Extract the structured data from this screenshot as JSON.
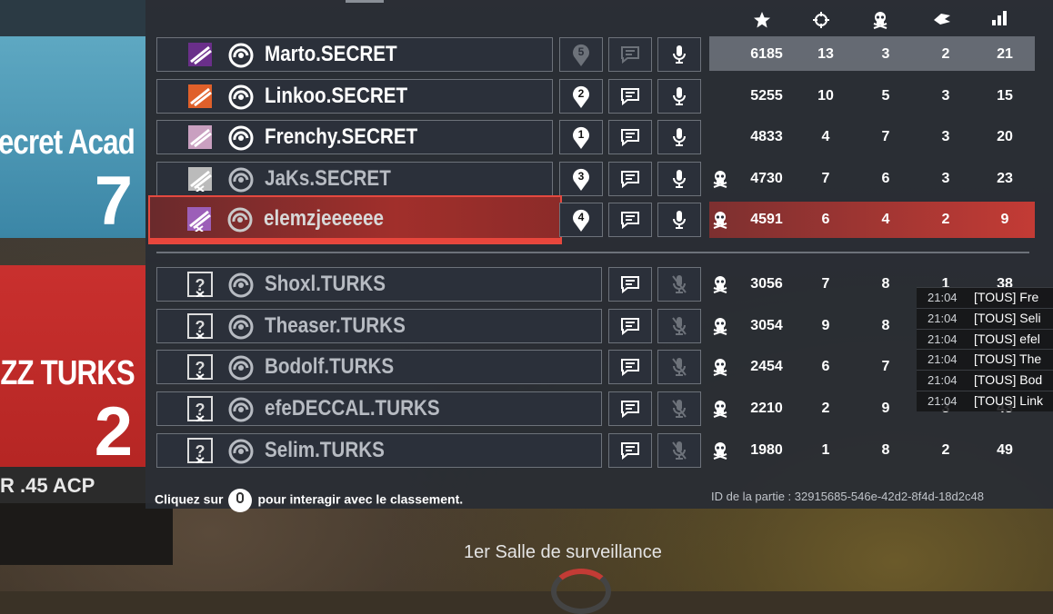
{
  "teams": [
    {
      "name": "ecret Acad",
      "score": "7",
      "color": "#4a97b5"
    },
    {
      "name": "ZZ TURKS",
      "score": "2",
      "color": "#c12c2a"
    }
  ],
  "weapon": "R .45 ACP",
  "header_icons": [
    "star-icon",
    "crosshair-icon",
    "skull-icon",
    "assist-icon",
    "signal-icon"
  ],
  "players": [
    {
      "name": "Marto.SECRET",
      "team": "secret",
      "badge": "5",
      "badge_state": "dim",
      "chat": "dim",
      "mic": "on",
      "dead": false,
      "score": "6185",
      "kills": "13",
      "deaths": "3",
      "assists": "2",
      "ping": "21"
    },
    {
      "name": "Linkoo.SECRET",
      "team": "secret",
      "badge": "2",
      "chat": "on",
      "mic": "on",
      "dead": false,
      "score": "5255",
      "kills": "10",
      "deaths": "5",
      "assists": "3",
      "ping": "15"
    },
    {
      "name": "Frenchy.SECRET",
      "team": "secret",
      "badge": "1",
      "chat": "on",
      "mic": "on",
      "dead": false,
      "score": "4833",
      "kills": "4",
      "deaths": "7",
      "assists": "3",
      "ping": "20"
    },
    {
      "name": "JaKs.SECRET",
      "team": "secret",
      "badge": "3",
      "chat": "on",
      "mic": "on",
      "dead": true,
      "score": "4730",
      "kills": "7",
      "deaths": "6",
      "assists": "3",
      "ping": "23"
    },
    {
      "name": "elemzjeeeeee",
      "team": "secret",
      "badge": "4",
      "chat": "on",
      "mic": "on",
      "dead": true,
      "score": "4591",
      "kills": "6",
      "deaths": "4",
      "assists": "2",
      "ping": "9",
      "self": true
    },
    {
      "name": "Shoxl.TURKS",
      "team": "turks",
      "chat": "on",
      "mic": "muted",
      "dead": true,
      "score": "3056",
      "kills": "7",
      "deaths": "8",
      "assists": "1",
      "ping": "38"
    },
    {
      "name": "Theaser.TURKS",
      "team": "turks",
      "chat": "on",
      "mic": "muted",
      "dead": true,
      "score": "3054",
      "kills": "9",
      "deaths": "8",
      "assists": "",
      "ping": ""
    },
    {
      "name": "Bodolf.TURKS",
      "team": "turks",
      "chat": "on",
      "mic": "muted",
      "dead": true,
      "score": "2454",
      "kills": "6",
      "deaths": "7",
      "assists": "",
      "ping": ""
    },
    {
      "name": "efeDECCAL.TURKS",
      "team": "turks",
      "chat": "on",
      "mic": "muted",
      "dead": true,
      "score": "2210",
      "kills": "2",
      "deaths": "9",
      "assists": "3",
      "ping": "43"
    },
    {
      "name": "Selim.TURKS",
      "team": "turks",
      "chat": "on",
      "mic": "muted",
      "dead": true,
      "score": "1980",
      "kills": "1",
      "deaths": "8",
      "assists": "2",
      "ping": "49"
    }
  ],
  "footer": {
    "click_prefix": "Cliquez sur",
    "click_suffix": "pour interagir avec le classement.",
    "match_id": "ID de la partie : 32915685-546e-42d2-8f4d-18d2c48"
  },
  "chat": [
    {
      "time": "21:04",
      "msg": "[TOUS] Fre"
    },
    {
      "time": "21:04",
      "msg": "[TOUS] Seli"
    },
    {
      "time": "21:04",
      "msg": "[TOUS] efel"
    },
    {
      "time": "21:04",
      "msg": "[TOUS] The"
    },
    {
      "time": "21:04",
      "msg": "[TOUS] Bod"
    },
    {
      "time": "21:04",
      "msg": "[TOUS] Link"
    }
  ],
  "location": "1er Salle de surveillance"
}
